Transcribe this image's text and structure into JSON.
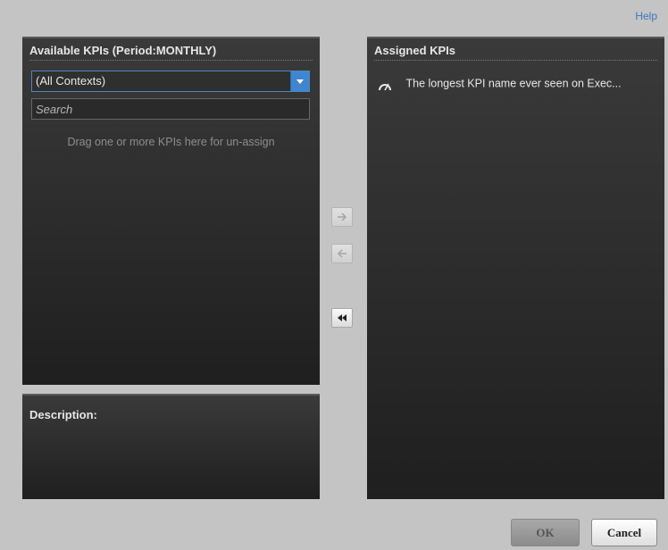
{
  "header": {
    "help_label": "Help"
  },
  "available": {
    "title": "Available KPIs (Period:MONTHLY)",
    "context_value": "(All Contexts)",
    "search_placeholder": "Search",
    "drop_hint": "Drag one or more KPIs here for un-assign"
  },
  "description": {
    "title": "Description:"
  },
  "assigned": {
    "title": "Assigned KPIs",
    "items": [
      {
        "label": "The longest KPI name ever seen on Exec...",
        "icon": "gauge-icon"
      }
    ]
  },
  "transfer": {
    "move_right_icon": "arrow-right-icon",
    "move_left_icon": "arrow-left-icon",
    "move_all_left_icon": "double-chevron-left-icon"
  },
  "footer": {
    "ok_label": "OK",
    "cancel_label": "Cancel"
  },
  "colors": {
    "accent": "#3f86cf",
    "panel_bg": "#2a2a2a",
    "page_bg": "#c4c4c4",
    "help_link": "#3a78c2"
  }
}
